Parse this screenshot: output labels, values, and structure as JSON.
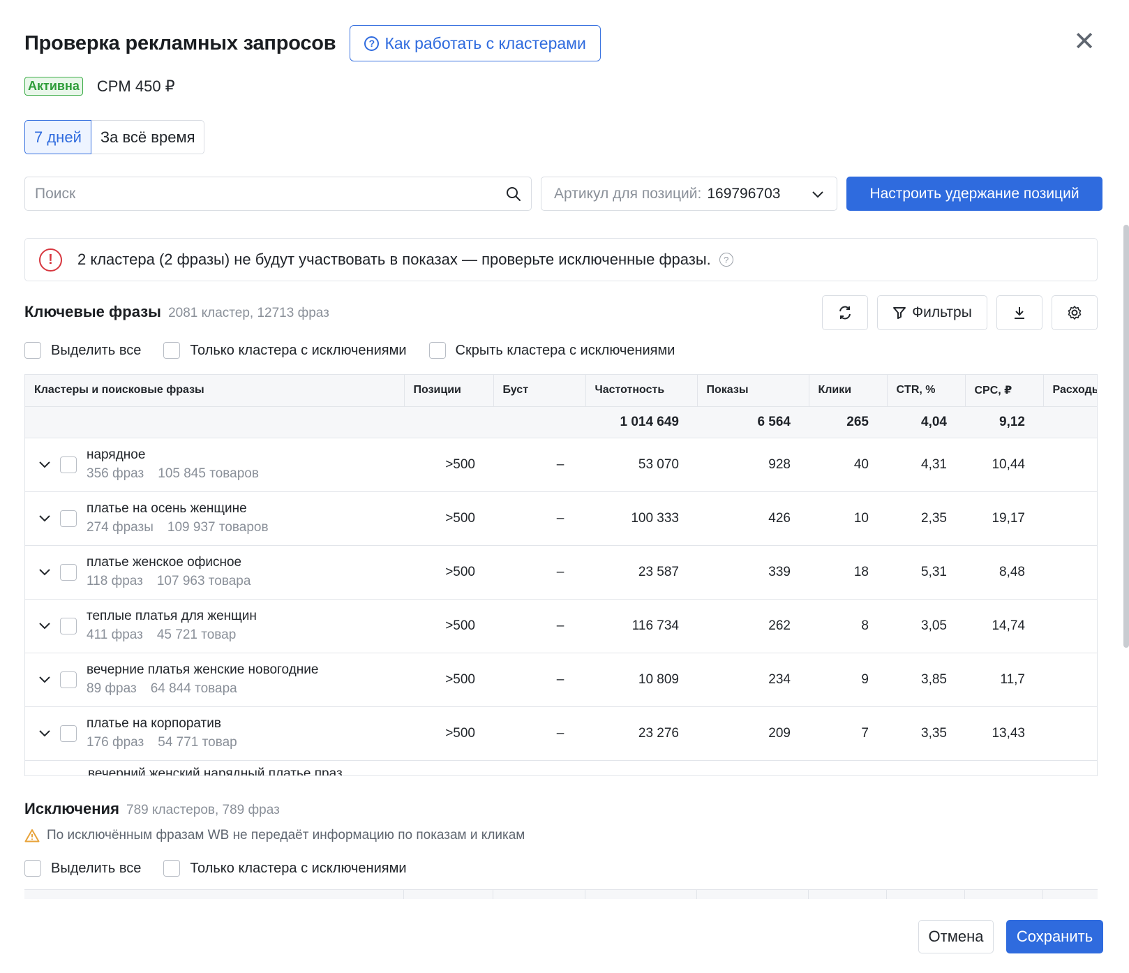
{
  "header": {
    "title": "Проверка рекламных запросов",
    "help_button": "Как работать с кластерами",
    "close_icon": "close-icon"
  },
  "status": {
    "badge": "Активна",
    "cpm": "CPM 450 ₽",
    "badge_color": "#3fae4a"
  },
  "period_tabs": [
    {
      "label": "7 дней",
      "active": true
    },
    {
      "label": "За всё время",
      "active": false
    }
  ],
  "search": {
    "placeholder": "Поиск"
  },
  "article": {
    "label": "Артикул для позиций:",
    "value": "169796703"
  },
  "primary_action": "Настроить удержание позиций",
  "alert": {
    "text": "2 кластера (2 фразы) не будут участвовать в показах — проверьте исключенные фразы."
  },
  "keywords": {
    "title": "Ключевые фразы",
    "subtitle": "2081 кластер, 12713 фраз",
    "filters_label": "Фильтры",
    "checks": [
      "Выделить все",
      "Только кластера с исключениями",
      "Скрыть кластера с исключениями"
    ]
  },
  "table": {
    "columns": [
      "Кластеры и поисковые фразы",
      "Позиции",
      "Буст",
      "Частотность",
      "Показы",
      "Клики",
      "CTR, %",
      "CPC, ₽",
      "Расходы"
    ],
    "totals": {
      "frequency": "1 014 649",
      "impressions": "6 564",
      "clicks": "265",
      "ctr": "4,04",
      "cpc": "9,12"
    },
    "rows": [
      {
        "name": "нарядное",
        "phrases": "356 фраз",
        "goods": "105 845 товаров",
        "position": ">500",
        "boost": "–",
        "frequency": "53 070",
        "impressions": "928",
        "clicks": "40",
        "ctr": "4,31",
        "ctr_status": "good",
        "cpc": "10,44",
        "cpc_status": "bad"
      },
      {
        "name": "платье на осень женщине",
        "phrases": "274 фразы",
        "goods": "109 937 товаров",
        "position": ">500",
        "boost": "–",
        "frequency": "100 333",
        "impressions": "426",
        "clicks": "10",
        "ctr": "2,35",
        "ctr_status": "bad",
        "cpc": "19,17",
        "cpc_status": "bad"
      },
      {
        "name": "платье женское офисное",
        "phrases": "118 фраз",
        "goods": "107 963 товара",
        "position": ">500",
        "boost": "–",
        "frequency": "23 587",
        "impressions": "339",
        "clicks": "18",
        "ctr": "5,31",
        "ctr_status": "good",
        "cpc": "8,48",
        "cpc_status": "good"
      },
      {
        "name": "теплые платья для женщин",
        "phrases": "411 фраз",
        "goods": "45 721 товар",
        "position": ">500",
        "boost": "–",
        "frequency": "116 734",
        "impressions": "262",
        "clicks": "8",
        "ctr": "3,05",
        "ctr_status": "bad",
        "cpc": "14,74",
        "cpc_status": "bad"
      },
      {
        "name": "вечерние платья женские новогодние",
        "phrases": "89 фраз",
        "goods": "64 844 товара",
        "position": ">500",
        "boost": "–",
        "frequency": "10 809",
        "impressions": "234",
        "clicks": "9",
        "ctr": "3,85",
        "ctr_status": "bad",
        "cpc": "11,7",
        "cpc_status": "bad"
      },
      {
        "name": "платье на корпоратив",
        "phrases": "176 фраз",
        "goods": "54 771 товар",
        "position": ">500",
        "boost": "–",
        "frequency": "23 276",
        "impressions": "209",
        "clicks": "7",
        "ctr": "3,35",
        "ctr_status": "bad",
        "cpc": "13,43",
        "cpc_status": "bad"
      }
    ],
    "partial_row": "вечерний женский нарядный платье праз"
  },
  "exclusions": {
    "title": "Исключения",
    "subtitle": "789 кластеров, 789 фраз",
    "note": "По исключённым фразам WB не передаёт информацию по показам и кликам",
    "checks": [
      "Выделить все",
      "Только кластера с исключениями"
    ]
  },
  "footer": {
    "cancel": "Отмена",
    "save": "Сохранить"
  },
  "colors": {
    "accent": "#2f6bde",
    "good": "#3a9d3f",
    "bad": "#d8383f",
    "alert": "#d7373f",
    "warning": "#e8a33a"
  }
}
